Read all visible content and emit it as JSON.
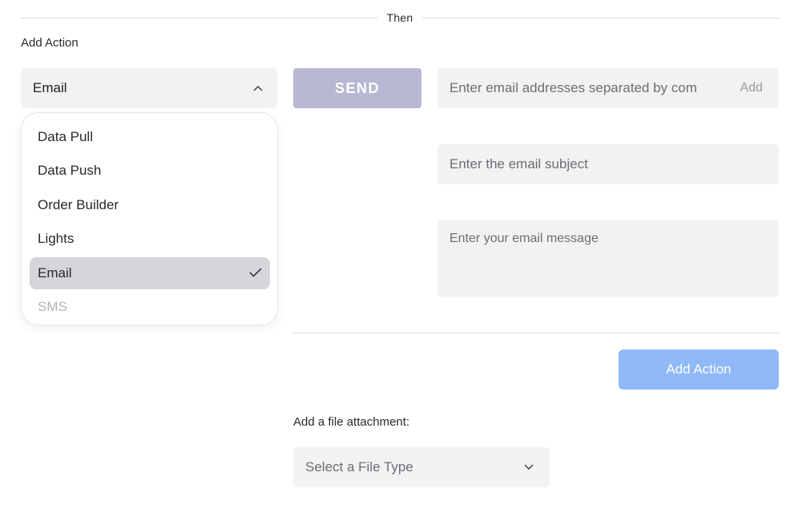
{
  "divider": {
    "label": "Then"
  },
  "section": {
    "title": "Add Action"
  },
  "action_select": {
    "value": "Email",
    "icon": "chevron-up-icon",
    "options": [
      {
        "label": "Data Pull"
      },
      {
        "label": "Data Push"
      },
      {
        "label": "Order Builder"
      },
      {
        "label": "Lights"
      },
      {
        "label": "Email",
        "selected": true
      },
      {
        "label": "SMS"
      }
    ]
  },
  "send_button": {
    "label": "SEND"
  },
  "email": {
    "recipients_placeholder": "Enter email addresses separated by com",
    "add_label": "Add",
    "subject_placeholder": "Enter the email subject",
    "message_placeholder": "Enter your email message"
  },
  "add_action_button": {
    "label": "Add Action"
  },
  "attachment": {
    "label": "Add a file attachment:",
    "select_placeholder": "Select a File Type",
    "icon": "chevron-down-icon"
  },
  "colors": {
    "send_button": "#b8b8d2",
    "add_action_button": "#8fb9f7",
    "field_background": "#f2f2f2",
    "selected_option": "#d5d5da"
  }
}
